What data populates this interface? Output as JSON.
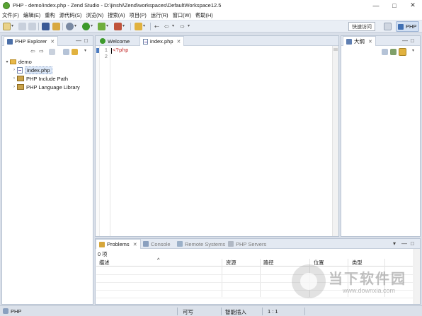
{
  "window": {
    "title": "PHP - demo/index.php - Zend Studio - D:\\jinshi\\Zend\\workspaces\\DefaultWorkspace12.5",
    "minimize_glyph": "—",
    "maximize_glyph": "□",
    "close_glyph": "✕"
  },
  "menu": [
    "文件(F)",
    "编辑(E)",
    "重构",
    "源代码(S)",
    "浏览(N)",
    "搜索(A)",
    "项目(P)",
    "运行(R)",
    "窗口(W)",
    "帮助(H)"
  ],
  "toolbar": {
    "quick_access": "快速访问",
    "perspective_label": "PHP"
  },
  "explorer": {
    "tab_label": "PHP Explorer",
    "tab_close": "✕",
    "minimize_glyph": "—",
    "maximize_glyph": "□",
    "tree": {
      "project": "demo",
      "project_twisty": "▾",
      "file": "index.php",
      "include_path": "PHP Include Path",
      "language_library": "PHP Language Library",
      "collapsed_twisty": "›"
    }
  },
  "editor": {
    "tabs": [
      {
        "label": "Welcome",
        "close": ""
      },
      {
        "label": "index.php",
        "close": "✕"
      }
    ],
    "lines": [
      {
        "number": "1",
        "code": "<?php"
      },
      {
        "number": "2",
        "code": ""
      }
    ]
  },
  "outline": {
    "tab_label": "大纲",
    "tab_close": "✕",
    "minimize_glyph": "—",
    "maximize_glyph": "□"
  },
  "bottom_panel": {
    "tabs": [
      {
        "label": "Problems",
        "close": "✕"
      },
      {
        "label": "Console",
        "close": ""
      },
      {
        "label": "Remote Systems",
        "close": ""
      },
      {
        "label": "PHP Servers",
        "close": ""
      }
    ],
    "count": "0 项",
    "columns": [
      "描述",
      "资源",
      "路径",
      "位置",
      "类型"
    ],
    "sort_indicator": "^"
  },
  "status": {
    "left": "PHP",
    "writable": "可写",
    "insert_mode": "智能插入",
    "position": "1 : 1"
  },
  "watermark": {
    "text": "当下软件园",
    "url": "www.downxia.com"
  },
  "colors": {
    "accent": "#3f6fb3",
    "php_tag": "#c02020",
    "run_green": "#3c9a2c"
  }
}
